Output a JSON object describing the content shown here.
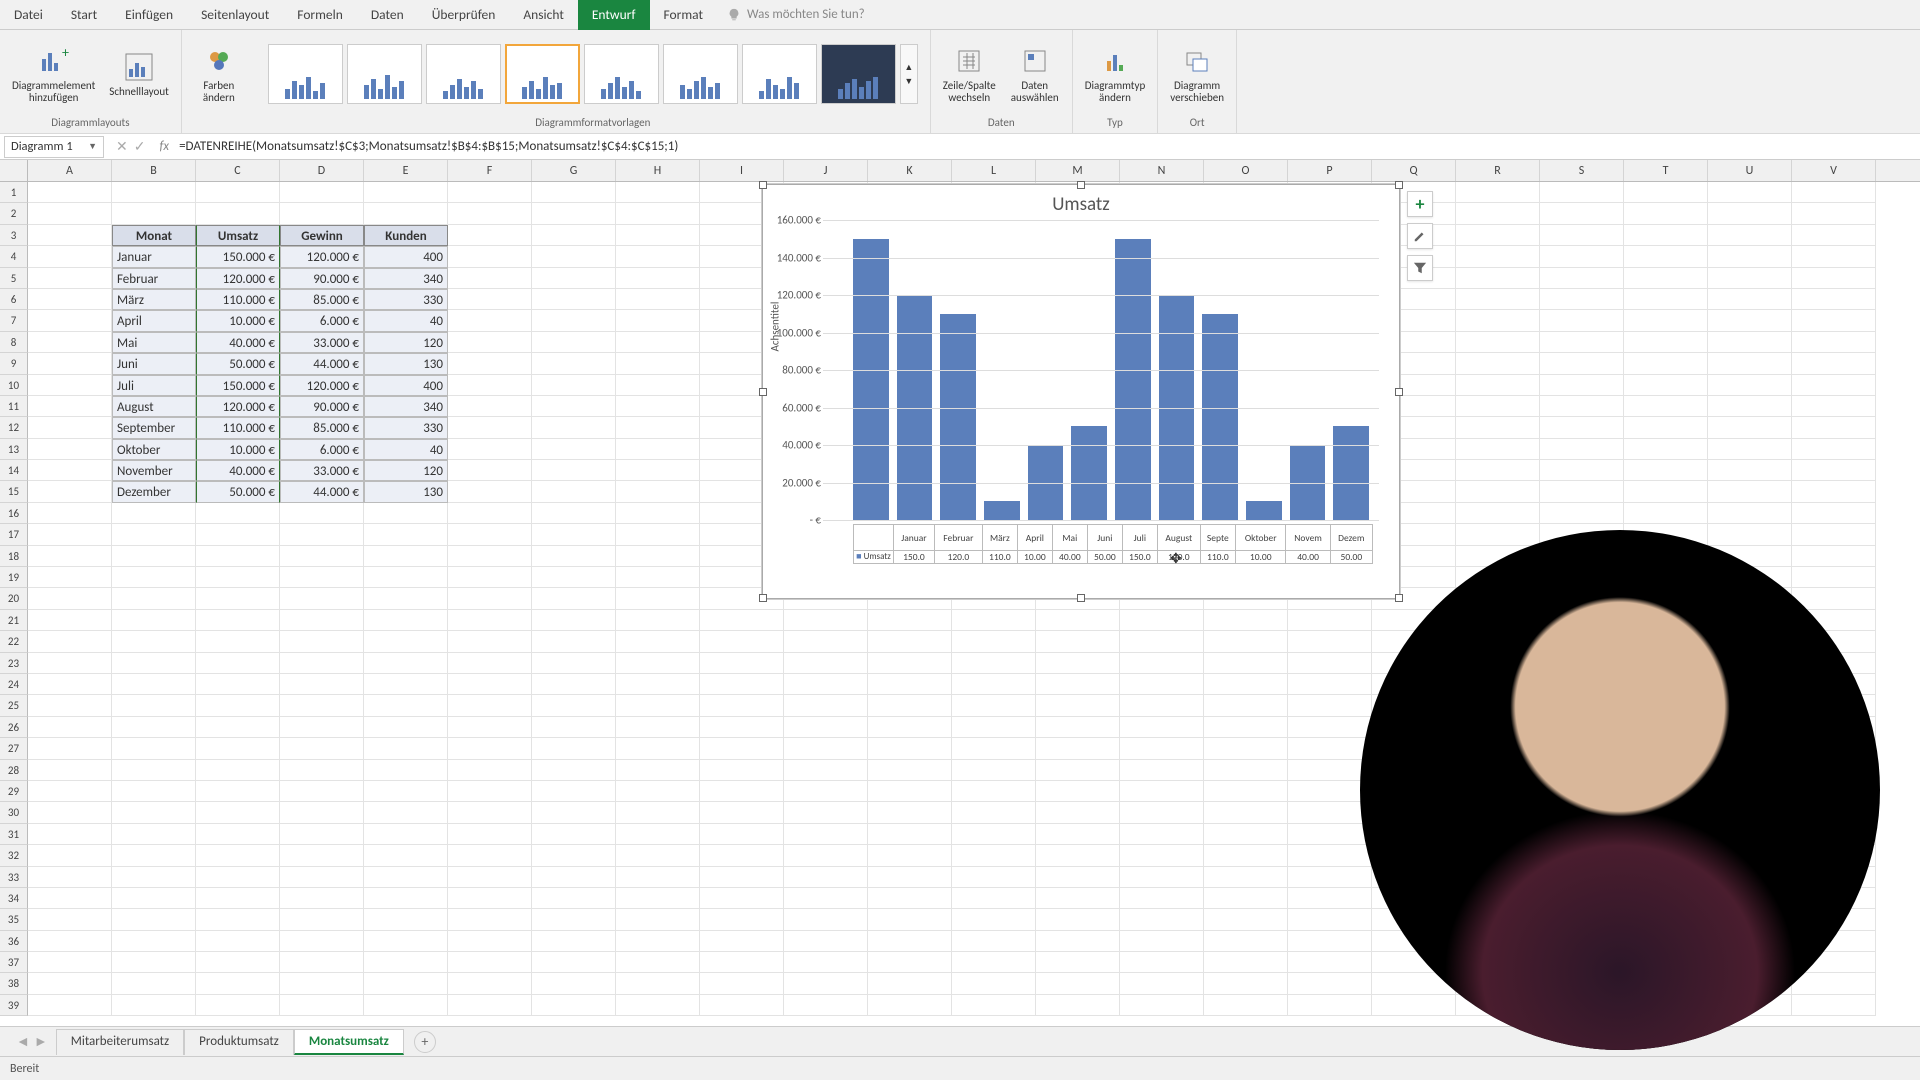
{
  "menu": [
    "Datei",
    "Start",
    "Einfügen",
    "Seitenlayout",
    "Formeln",
    "Daten",
    "Überprüfen",
    "Ansicht",
    "Entwurf",
    "Format"
  ],
  "menu_active": 8,
  "tellme": "Was möchten Sie tun?",
  "ribbon": {
    "group1": "Diagrammlayouts",
    "btn_add": "Diagrammelement\nhinzufügen",
    "btn_quick": "Schnelllayout",
    "btn_colors": "Farben\nändern",
    "group2": "Diagrammformatvorlagen",
    "group3": "Daten",
    "btn_switch": "Zeile/Spalte\nwechseln",
    "btn_select": "Daten\nauswählen",
    "group4": "Typ",
    "btn_type": "Diagrammtyp\nändern",
    "group5": "Ort",
    "btn_move": "Diagramm\nverschieben"
  },
  "namebox": "Diagramm 1",
  "formula": "=DATENREIHE(Monatsumsatz!$C$3;Monatsumsatz!$B$4:$B$15;Monatsumsatz!$C$4:$C$15;1)",
  "columns": [
    "A",
    "B",
    "C",
    "D",
    "E",
    "F",
    "G",
    "H",
    "I",
    "J",
    "K",
    "L",
    "M",
    "N",
    "O",
    "P",
    "Q",
    "R",
    "S",
    "T",
    "U",
    "V"
  ],
  "table": {
    "headers": [
      "Monat",
      "Umsatz",
      "Gewinn",
      "Kunden"
    ],
    "rows": [
      [
        "Januar",
        "150.000 €",
        "120.000 €",
        "400"
      ],
      [
        "Februar",
        "120.000 €",
        "90.000 €",
        "340"
      ],
      [
        "März",
        "110.000 €",
        "85.000 €",
        "330"
      ],
      [
        "April",
        "10.000 €",
        "6.000 €",
        "40"
      ],
      [
        "Mai",
        "40.000 €",
        "33.000 €",
        "120"
      ],
      [
        "Juni",
        "50.000 €",
        "44.000 €",
        "130"
      ],
      [
        "Juli",
        "150.000 €",
        "120.000 €",
        "400"
      ],
      [
        "August",
        "120.000 €",
        "90.000 €",
        "340"
      ],
      [
        "September",
        "110.000 €",
        "85.000 €",
        "330"
      ],
      [
        "Oktober",
        "10.000 €",
        "6.000 €",
        "40"
      ],
      [
        "November",
        "40.000 €",
        "33.000 €",
        "120"
      ],
      [
        "Dezember",
        "50.000 €",
        "44.000 €",
        "130"
      ]
    ]
  },
  "chart_data": {
    "type": "bar",
    "title": "Umsatz",
    "yaxis_title": "Achsentitel",
    "series_name": "Umsatz",
    "categories": [
      "Januar",
      "Februar",
      "März",
      "April",
      "Mai",
      "Juni",
      "Juli",
      "August",
      "September",
      "Oktober",
      "November",
      "Dezember"
    ],
    "categories_short": [
      "Januar",
      "Februar",
      "März",
      "April",
      "Mai",
      "Juni",
      "Juli",
      "August",
      "September",
      "Oktober",
      "November",
      "Dezember"
    ],
    "values": [
      150000,
      120000,
      110000,
      10000,
      40000,
      50000,
      150000,
      120000,
      110000,
      10000,
      40000,
      50000
    ],
    "value_labels": [
      "150.0",
      "120.0",
      "110.0",
      "10.00",
      "40.00",
      "50.00",
      "150.0",
      "120.0",
      "110.0",
      "10.00",
      "40.00",
      "50.00"
    ],
    "ylim": [
      0,
      160000
    ],
    "yticks": [
      "-   €",
      "20.000 €",
      "40.000 €",
      "60.000 €",
      "80.000 €",
      "100.000 €",
      "120.000 €",
      "140.000 €",
      "160.000 €"
    ]
  },
  "sheettabs": [
    "Mitarbeiterumsatz",
    "Produktumsatz",
    "Monatsumsatz"
  ],
  "sheettab_active": 2,
  "status": "Bereit"
}
